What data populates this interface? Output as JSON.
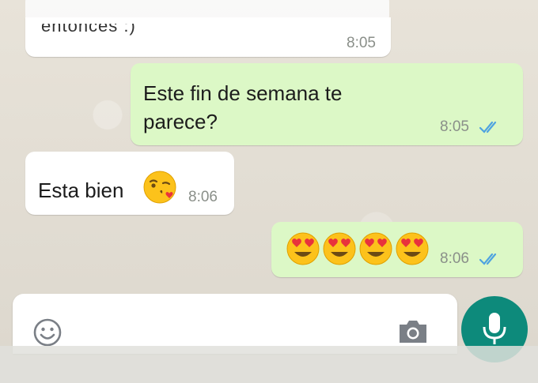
{
  "conversation": {
    "previous_message": {
      "text": "entonces :)",
      "time": "8:05"
    },
    "messages": [
      {
        "direction": "outgoing",
        "line1": "Este fin de semana te",
        "line2": "parece?",
        "time": "8:05",
        "status": "read"
      },
      {
        "direction": "incoming",
        "text": "Esta bien",
        "emoji": "face-blowing-kiss-icon",
        "time": "8:06"
      },
      {
        "direction": "outgoing",
        "emojis": [
          "heart-eyes-icon",
          "heart-eyes-icon",
          "heart-eyes-icon",
          "heart-eyes-icon"
        ],
        "time": "8:06",
        "status": "read"
      }
    ]
  },
  "input_bar": {
    "emoji_icon": "smiley-icon",
    "camera_icon": "camera-icon",
    "mic_icon": "mic-icon"
  },
  "colors": {
    "outgoing_bubble": "#dcf8c6",
    "incoming_bubble": "#ffffff",
    "read_ticks": "#4fa3e0",
    "mic_button": "#0d8a7b"
  }
}
